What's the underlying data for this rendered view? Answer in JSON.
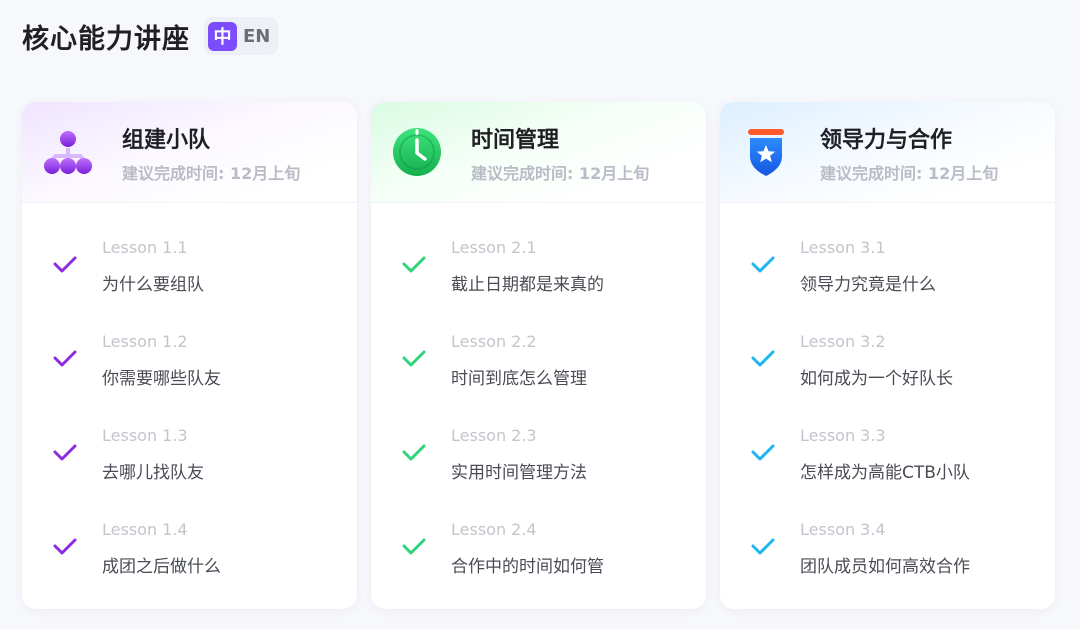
{
  "header": {
    "title": "核心能力讲座",
    "lang_zh": "中",
    "lang_en": "EN"
  },
  "colors": {
    "purple": "#8b2be2",
    "green": "#2ed47a",
    "blue": "#1fb6f0"
  },
  "cards": [
    {
      "title": "组建小队",
      "subtitle": "建议完成时间: 12月上旬",
      "icon": "team-hierarchy-icon",
      "lessons": [
        {
          "num": "Lesson 1.1",
          "name": "为什么要组队"
        },
        {
          "num": "Lesson 1.2",
          "name": "你需要哪些队友"
        },
        {
          "num": "Lesson 1.3",
          "name": "去哪儿找队友"
        },
        {
          "num": "Lesson 1.4",
          "name": "成团之后做什么"
        }
      ]
    },
    {
      "title": "时间管理",
      "subtitle": "建议完成时间: 12月上旬",
      "icon": "clock-icon",
      "lessons": [
        {
          "num": "Lesson 2.1",
          "name": "截止日期都是来真的"
        },
        {
          "num": "Lesson 2.2",
          "name": "时间到底怎么管理"
        },
        {
          "num": "Lesson 2.3",
          "name": "实用时间管理方法"
        },
        {
          "num": "Lesson 2.4",
          "name": "合作中的时间如何管"
        }
      ]
    },
    {
      "title": "领导力与合作",
      "subtitle": "建议完成时间: 12月上旬",
      "icon": "star-badge-icon",
      "lessons": [
        {
          "num": "Lesson 3.1",
          "name": "领导力究竟是什么"
        },
        {
          "num": "Lesson 3.2",
          "name": "如何成为一个好队长"
        },
        {
          "num": "Lesson 3.3",
          "name": "怎样成为高能CTB小队"
        },
        {
          "num": "Lesson 3.4",
          "name": "团队成员如何高效合作"
        }
      ]
    }
  ]
}
